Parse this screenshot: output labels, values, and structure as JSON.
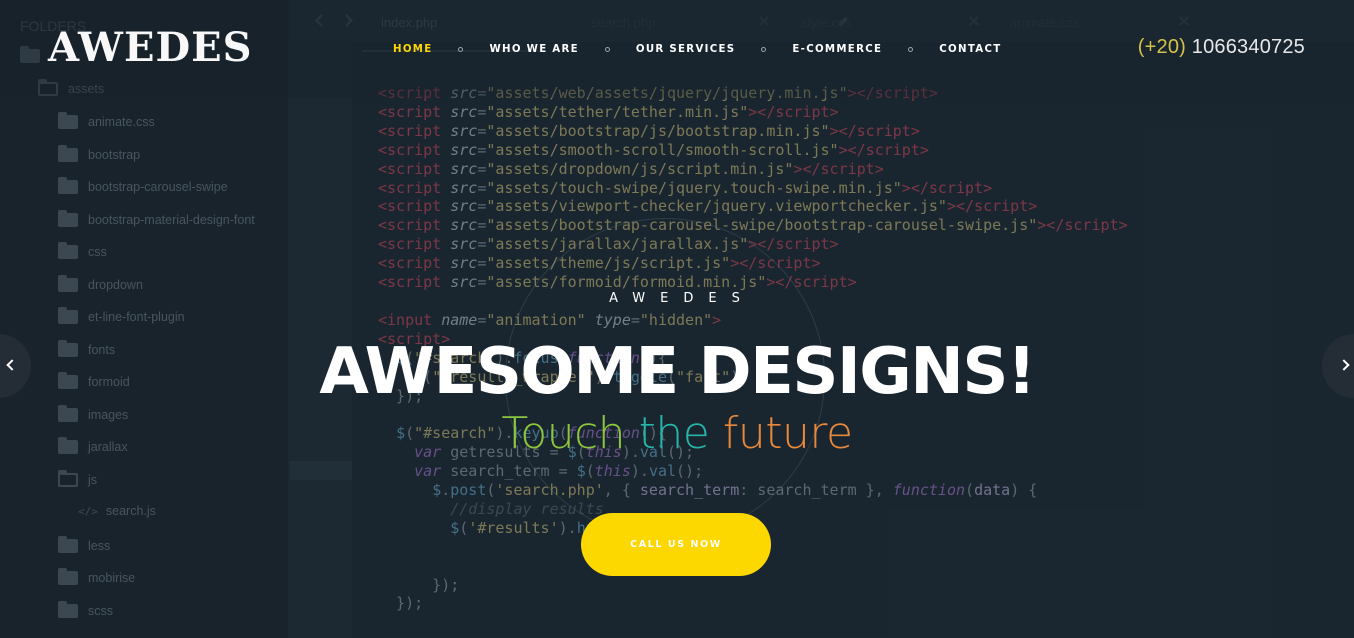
{
  "header": {
    "logo": "AWEDES",
    "nav": [
      {
        "label": "HOME",
        "active": true
      },
      {
        "label": "WHO WE ARE",
        "active": false
      },
      {
        "label": "OUR SERVICES",
        "active": false
      },
      {
        "label": "E-COMMERCE",
        "active": false
      },
      {
        "label": "CONTACT",
        "active": false
      }
    ],
    "phone_code": "(+20)",
    "phone_number": "1066340725"
  },
  "hero": {
    "kicker": "AWEDES",
    "title": "AWESOME DESIGNS!",
    "subtitle_words": [
      "Touch",
      "the",
      "future"
    ],
    "cta_label": "CALL US NOW"
  },
  "background_editor": {
    "folders_title": "FOLDERS",
    "tree": [
      {
        "label": "",
        "type": "folder"
      },
      {
        "label": "assets",
        "type": "folder-open"
      },
      {
        "label": "animate.css",
        "type": "folder"
      },
      {
        "label": "bootstrap",
        "type": "folder"
      },
      {
        "label": "bootstrap-carousel-swipe",
        "type": "folder"
      },
      {
        "label": "bootstrap-material-design-font",
        "type": "folder"
      },
      {
        "label": "css",
        "type": "folder"
      },
      {
        "label": "dropdown",
        "type": "folder"
      },
      {
        "label": "et-line-font-plugin",
        "type": "folder"
      },
      {
        "label": "fonts",
        "type": "folder"
      },
      {
        "label": "formoid",
        "type": "folder"
      },
      {
        "label": "images",
        "type": "folder"
      },
      {
        "label": "jarallax",
        "type": "folder"
      },
      {
        "label": "js",
        "type": "folder-open"
      },
      {
        "label": "search.js",
        "type": "file"
      },
      {
        "label": "less",
        "type": "folder"
      },
      {
        "label": "mobirise",
        "type": "folder"
      },
      {
        "label": "scss",
        "type": "folder"
      }
    ],
    "tabs": [
      "index.php",
      "search.php",
      "style.css",
      "animate.css"
    ],
    "gutter_highlight": "672"
  },
  "colors": {
    "accent": "#fdd700",
    "phone_code": "#d5c24a",
    "subtitle": [
      "#8cc63f",
      "#26b5a8",
      "#e8883a"
    ]
  },
  "icons": {
    "prev": "chevron-left-icon",
    "next": "chevron-right-icon"
  }
}
